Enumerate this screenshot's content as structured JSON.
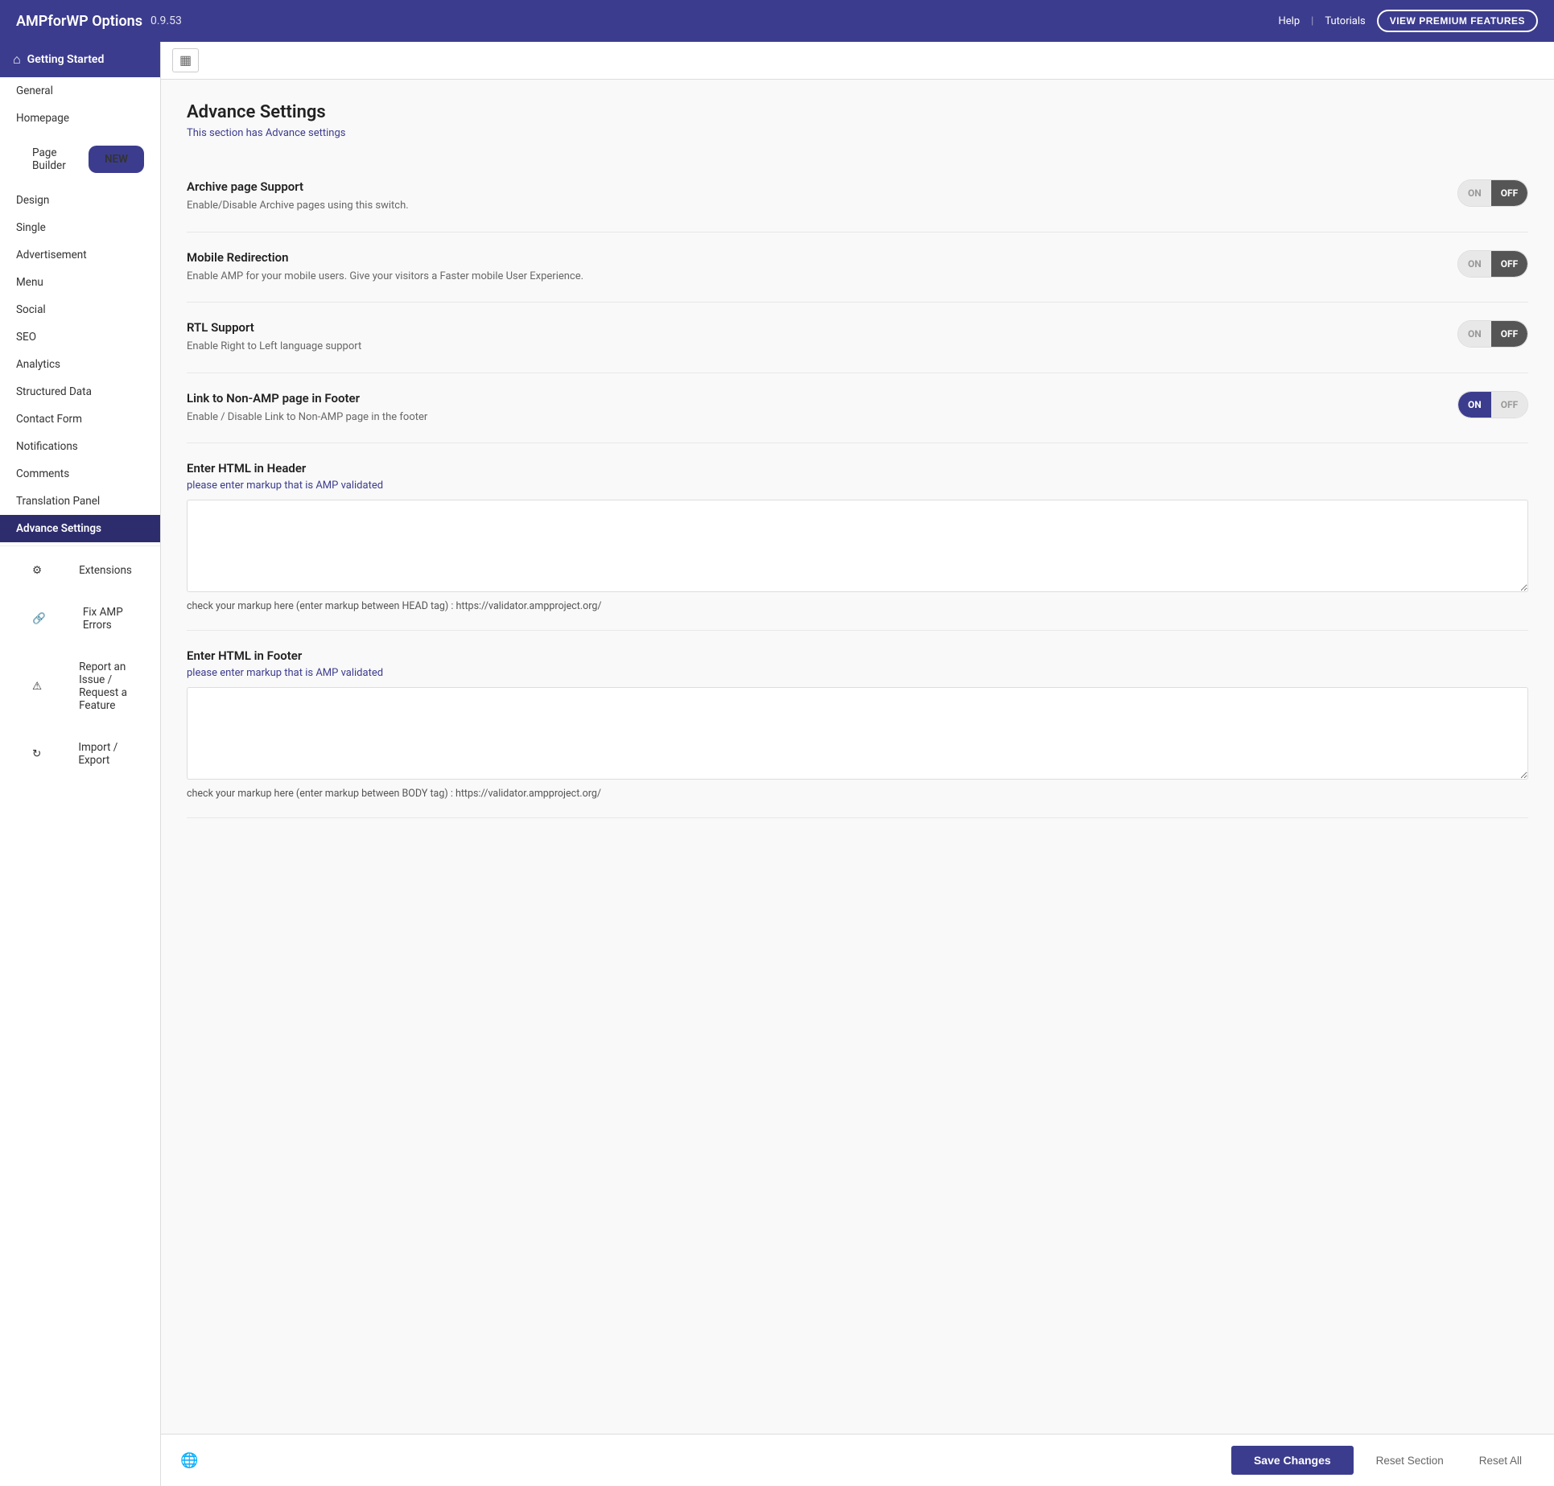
{
  "header": {
    "title": "AMPforWP Options",
    "version": "0.9.53",
    "help_label": "Help",
    "tutorials_label": "Tutorials",
    "premium_btn": "VIEW PREMIUM FEATURES"
  },
  "sidebar": {
    "getting_started": "Getting Started",
    "nav_items": [
      {
        "id": "general",
        "label": "General",
        "active": false
      },
      {
        "id": "homepage",
        "label": "Homepage",
        "active": false
      },
      {
        "id": "page-builder",
        "label": "Page Builder",
        "badge": "NEW",
        "active": false
      },
      {
        "id": "design",
        "label": "Design",
        "active": false
      },
      {
        "id": "single",
        "label": "Single",
        "active": false
      },
      {
        "id": "advertisement",
        "label": "Advertisement",
        "active": false
      },
      {
        "id": "menu",
        "label": "Menu",
        "active": false
      },
      {
        "id": "social",
        "label": "Social",
        "active": false
      },
      {
        "id": "seo",
        "label": "SEO",
        "active": false
      },
      {
        "id": "analytics",
        "label": "Analytics",
        "active": false
      },
      {
        "id": "structured-data",
        "label": "Structured Data",
        "active": false
      },
      {
        "id": "contact-form",
        "label": "Contact Form",
        "active": false
      },
      {
        "id": "notifications",
        "label": "Notifications",
        "active": false
      },
      {
        "id": "comments",
        "label": "Comments",
        "active": false
      },
      {
        "id": "translation-panel",
        "label": "Translation Panel",
        "active": false
      },
      {
        "id": "advance-settings",
        "label": "Advance Settings",
        "active": true
      }
    ],
    "extra_items": [
      {
        "id": "extensions",
        "label": "Extensions",
        "icon": "⚙"
      },
      {
        "id": "fix-amp-errors",
        "label": "Fix AMP Errors",
        "icon": "🔗"
      },
      {
        "id": "report-issue",
        "label": "Report an Issue / Request a Feature",
        "icon": "⚠"
      },
      {
        "id": "import-export",
        "label": "Import / Export",
        "icon": "↻"
      }
    ]
  },
  "main": {
    "page_title": "Advance Settings",
    "page_subtitle": "This section has Advance settings",
    "toolbar_icon": "▦",
    "settings": [
      {
        "id": "archive-page-support",
        "label": "Archive page Support",
        "desc": "Enable/Disable Archive pages using this switch.",
        "state": "off"
      },
      {
        "id": "mobile-redirection",
        "label": "Mobile Redirection",
        "desc": "Enable AMP for your mobile users. Give your visitors a Faster mobile User Experience.",
        "state": "off"
      },
      {
        "id": "rtl-support",
        "label": "RTL Support",
        "desc": "Enable Right to Left language support",
        "state": "off"
      },
      {
        "id": "link-non-amp-footer",
        "label": "Link to Non-AMP page in Footer",
        "desc": "Enable / Disable Link to Non-AMP page in the footer",
        "state": "on"
      }
    ],
    "html_header": {
      "label": "Enter HTML in Header",
      "placeholder_desc": "please enter markup that is AMP validated",
      "note": "check your markup here (enter markup between HEAD tag) : https://validator.ampproject.org/",
      "note_url": "https://validator.ampproject.org/"
    },
    "html_footer": {
      "label": "Enter HTML in Footer",
      "placeholder_desc": "please enter markup that is AMP validated",
      "note": "check your markup here (enter markup between BODY tag) : https://validator.ampproject.org/",
      "note_url": "https://validator.ampproject.org/"
    },
    "toggle_on_label": "ON",
    "toggle_off_label": "OFF"
  },
  "footer": {
    "save_label": "Save Changes",
    "reset_section_label": "Reset Section",
    "reset_all_label": "Reset All"
  }
}
